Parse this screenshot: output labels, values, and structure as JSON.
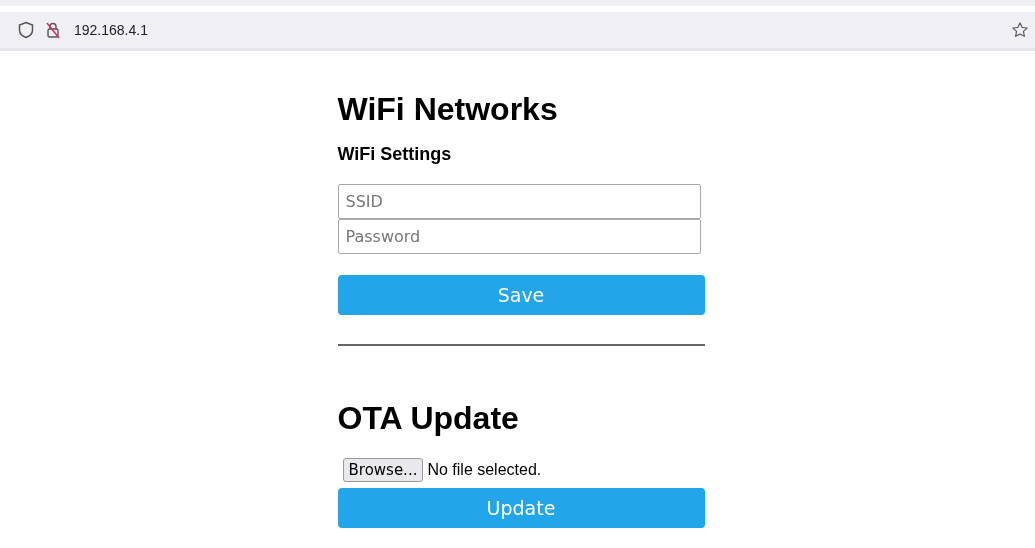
{
  "browser": {
    "url": "192.168.4.1"
  },
  "title": "WiFi Networks",
  "settings": {
    "heading": "WiFi Settings",
    "fields": [
      {
        "placeholder": "SSID"
      },
      {
        "placeholder": "Password"
      }
    ],
    "button": "Save"
  },
  "ota": {
    "title": "OTA Update",
    "browse_button": "Browse...",
    "file_status": "No file selected.",
    "button": "Update"
  }
}
